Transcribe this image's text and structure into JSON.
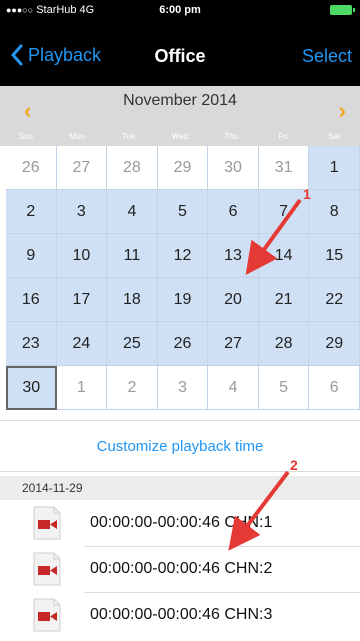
{
  "status_bar": {
    "signal_dots": "●●●○○",
    "carrier": "StarHub",
    "network": "4G",
    "time": "6:00 pm"
  },
  "nav": {
    "back_label": "Playback",
    "title": "Office",
    "select_label": "Select"
  },
  "calendar": {
    "month_label": "November 2014",
    "prev_icon": "‹",
    "next_icon": "›",
    "weekdays": [
      "Sun",
      "Mon",
      "Tue",
      "Wed",
      "Thu",
      "Fri",
      "Sat"
    ],
    "days": [
      {
        "label": "26",
        "state": "other"
      },
      {
        "label": "27",
        "state": "other"
      },
      {
        "label": "28",
        "state": "other"
      },
      {
        "label": "29",
        "state": "other"
      },
      {
        "label": "30",
        "state": "other"
      },
      {
        "label": "31",
        "state": "other"
      },
      {
        "label": "1",
        "state": "current"
      },
      {
        "label": "2",
        "state": "current"
      },
      {
        "label": "3",
        "state": "current"
      },
      {
        "label": "4",
        "state": "current"
      },
      {
        "label": "5",
        "state": "current"
      },
      {
        "label": "6",
        "state": "current"
      },
      {
        "label": "7",
        "state": "current"
      },
      {
        "label": "8",
        "state": "current"
      },
      {
        "label": "9",
        "state": "current"
      },
      {
        "label": "10",
        "state": "current"
      },
      {
        "label": "11",
        "state": "current"
      },
      {
        "label": "12",
        "state": "current"
      },
      {
        "label": "13",
        "state": "current"
      },
      {
        "label": "14",
        "state": "current"
      },
      {
        "label": "15",
        "state": "current"
      },
      {
        "label": "16",
        "state": "current"
      },
      {
        "label": "17",
        "state": "current"
      },
      {
        "label": "18",
        "state": "current"
      },
      {
        "label": "19",
        "state": "current"
      },
      {
        "label": "20",
        "state": "current"
      },
      {
        "label": "21",
        "state": "current"
      },
      {
        "label": "22",
        "state": "current"
      },
      {
        "label": "23",
        "state": "current"
      },
      {
        "label": "24",
        "state": "current"
      },
      {
        "label": "25",
        "state": "current"
      },
      {
        "label": "26",
        "state": "current"
      },
      {
        "label": "27",
        "state": "current"
      },
      {
        "label": "28",
        "state": "current"
      },
      {
        "label": "29",
        "state": "current"
      },
      {
        "label": "30",
        "state": "selected"
      },
      {
        "label": "1",
        "state": "other"
      },
      {
        "label": "2",
        "state": "other"
      },
      {
        "label": "3",
        "state": "other"
      },
      {
        "label": "4",
        "state": "other"
      },
      {
        "label": "5",
        "state": "other"
      },
      {
        "label": "6",
        "state": "other"
      }
    ]
  },
  "customize_label": "Customize playback time",
  "recordings": {
    "date": "2014-11-29",
    "items": [
      {
        "label": "00:00:00-00:00:46 CHN:1"
      },
      {
        "label": "00:00:00-00:00:46 CHN:2"
      },
      {
        "label": "00:00:00-00:00:46 CHN:3"
      }
    ]
  },
  "annotations": [
    {
      "label": "1"
    },
    {
      "label": "2"
    }
  ],
  "colors": {
    "accent": "#2196f3",
    "calendar_highlight": "#cfe0f5",
    "arrow_orange": "#f5a623",
    "annotation_red": "#e53935",
    "record_icon_red": "#c62828"
  }
}
